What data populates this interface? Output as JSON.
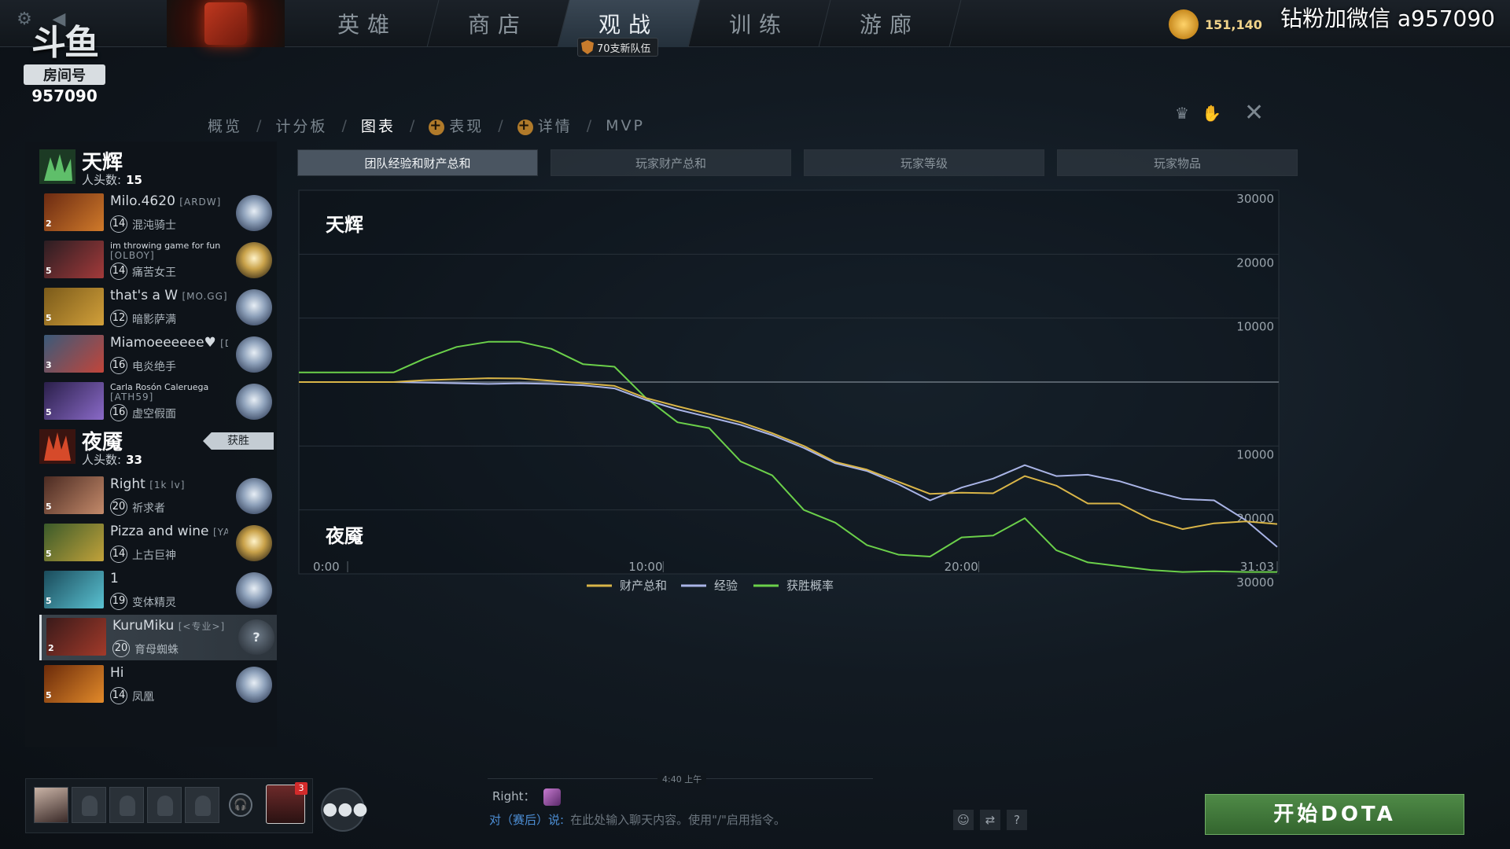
{
  "watermark": "钻粉加微信 a957090",
  "room": {
    "logo": "斗鱼",
    "label": "房间号",
    "number": "957090"
  },
  "nav": {
    "items": [
      {
        "label": "英雄"
      },
      {
        "label": "商店"
      },
      {
        "label": "观战",
        "active": true
      },
      {
        "label": "训练"
      },
      {
        "label": "游廊"
      }
    ],
    "badge": "70支新队伍"
  },
  "currency": {
    "amount": "151,140",
    "icon": "shard-coin-icon"
  },
  "breadcrumb": {
    "items": [
      "概览",
      "计分板",
      "图表",
      "表现",
      "详情",
      "MVP"
    ],
    "current": "图表",
    "separator": "/"
  },
  "tabs": [
    "团队经验和财产总和",
    "玩家财产总和",
    "玩家等级",
    "玩家物品"
  ],
  "teams": {
    "radiant": {
      "name": "天辉",
      "kills_label": "人头数:",
      "kills": "15",
      "players": [
        {
          "name": "Milo.4620",
          "tag": "[ARDW]",
          "level": "14",
          "hero": "混沌骑士",
          "pos": "2",
          "colors": [
            "#6b2a12",
            "#d07a2a"
          ],
          "medal": "silver"
        },
        {
          "name": "im throwing game for fun",
          "tag": "[OLBOY]",
          "level": "14",
          "hero": "痛苦女王",
          "pos": "5",
          "colors": [
            "#2a1d22",
            "#a33a3a"
          ],
          "medal": "gold"
        },
        {
          "name": "that's a W",
          "tag": "[MO.GG]",
          "level": "12",
          "hero": "暗影萨满",
          "pos": "5",
          "colors": [
            "#7a5a1a",
            "#d2a03a"
          ],
          "medal": "silver"
        },
        {
          "name": "Miamoeeeeee♥",
          "tag": "[DETS]",
          "level": "16",
          "hero": "电炎绝手",
          "pos": "3",
          "colors": [
            "#3a5a7a",
            "#c2453a"
          ],
          "medal": "silver"
        },
        {
          "name": "Carla Rosón Caleruega",
          "tag": "[ATH59]",
          "level": "16",
          "hero": "虚空假面",
          "pos": "5",
          "colors": [
            "#2a1f4a",
            "#8a6ac8"
          ],
          "medal": "silver"
        }
      ]
    },
    "dire": {
      "name": "夜魇",
      "kills_label": "人头数:",
      "kills": "33",
      "win_label": "获胜",
      "players": [
        {
          "name": "Right",
          "tag": "[1k lv]",
          "level": "20",
          "hero": "祈求者",
          "pos": "5",
          "colors": [
            "#4a2a22",
            "#c48a6a"
          ],
          "medal": "silver"
        },
        {
          "name": "Pizza and wine",
          "tag": "[YAHH]",
          "level": "14",
          "hero": "上古巨神",
          "pos": "5",
          "colors": [
            "#3a5a2a",
            "#c2a23a"
          ],
          "medal": "gold"
        },
        {
          "name": "1",
          "tag": "",
          "level": "19",
          "hero": "变体精灵",
          "pos": "5",
          "colors": [
            "#1a4a5a",
            "#5ac2d2"
          ],
          "medal": "silver"
        },
        {
          "name": "KuruMiku",
          "tag": "[<专业>]",
          "level": "20",
          "hero": "育母蜘蛛",
          "pos": "2",
          "colors": [
            "#3a1a1a",
            "#a23a2a"
          ],
          "medal": "unknown",
          "selected": true
        },
        {
          "name": "Hi",
          "tag": "",
          "level": "14",
          "hero": "凤凰",
          "pos": "5",
          "colors": [
            "#6a2a0a",
            "#e28a2a"
          ],
          "medal": "silver"
        }
      ]
    }
  },
  "chart_data": {
    "type": "line",
    "title": "团队经验和财产总和",
    "top_label": "天辉",
    "bottom_label": "夜魇",
    "y_ticks_top": [
      "30000",
      "20000",
      "10000"
    ],
    "y_ticks_bottom": [
      "10000",
      "20000",
      "30000"
    ],
    "x_ticks": [
      "0:00",
      "10:00",
      "20:00",
      "31:03"
    ],
    "xlim": [
      0,
      31.05
    ],
    "ylim": [
      -30000,
      30000
    ],
    "series": [
      {
        "name": "财产总和",
        "color": "#d9b548",
        "x": [
          0,
          3,
          4,
          6,
          7,
          8,
          9,
          10,
          11,
          12,
          13,
          14,
          15,
          16,
          17,
          18,
          19,
          20,
          21,
          22,
          23,
          24,
          25,
          26,
          27,
          28,
          29,
          30,
          31
        ],
        "y": [
          0,
          0,
          300,
          600,
          550,
          200,
          -200,
          -600,
          -2500,
          -3800,
          -5000,
          -6300,
          -8000,
          -10000,
          -12500,
          -13700,
          -15600,
          -17500,
          -17300,
          -17400,
          -14700,
          -16200,
          -19000,
          -19000,
          -21500,
          -23000,
          -22100,
          -21800,
          -22200
        ]
      },
      {
        "name": "经验",
        "color": "#a9b4e6",
        "x": [
          0,
          3,
          4,
          6,
          7,
          8,
          9,
          10,
          11,
          12,
          13,
          14,
          15,
          16,
          17,
          18,
          19,
          20,
          21,
          22,
          23,
          24,
          25,
          26,
          27,
          28,
          29,
          30,
          31
        ],
        "y": [
          0,
          0,
          -100,
          -300,
          -200,
          -300,
          -500,
          -1000,
          -2800,
          -4300,
          -5500,
          -6700,
          -8300,
          -10300,
          -12700,
          -13900,
          -16000,
          -18500,
          -16500,
          -15100,
          -13000,
          -14700,
          -14500,
          -15500,
          -17000,
          -18300,
          -18500,
          -21600,
          -25800
        ]
      },
      {
        "name": "获胜概率",
        "color": "#6bd04a",
        "x": [
          0,
          3,
          4,
          5,
          6,
          7,
          8,
          9,
          10,
          11,
          12,
          13,
          14,
          15,
          16,
          17,
          18,
          19,
          20,
          21,
          22,
          23,
          24,
          25,
          26,
          27,
          28,
          29,
          30,
          31
        ],
        "y": [
          1500,
          1500,
          3700,
          5500,
          6300,
          6300,
          5200,
          2800,
          2400,
          -2500,
          -6300,
          -7200,
          -12400,
          -14600,
          -20000,
          -22000,
          -25500,
          -27000,
          -27300,
          -24300,
          -24000,
          -21300,
          -26300,
          -28200,
          -28800,
          -29400,
          -29700,
          -29600,
          -29700,
          -29700
        ]
      }
    ]
  },
  "chat": {
    "time": "4:40 上午",
    "sender": "Right：",
    "to_label": "对（赛后）说:",
    "placeholder": "在此处输入聊天内容。使用\"/\"启用指令。"
  },
  "notification_count": "3",
  "play_button": "开始DOTA"
}
